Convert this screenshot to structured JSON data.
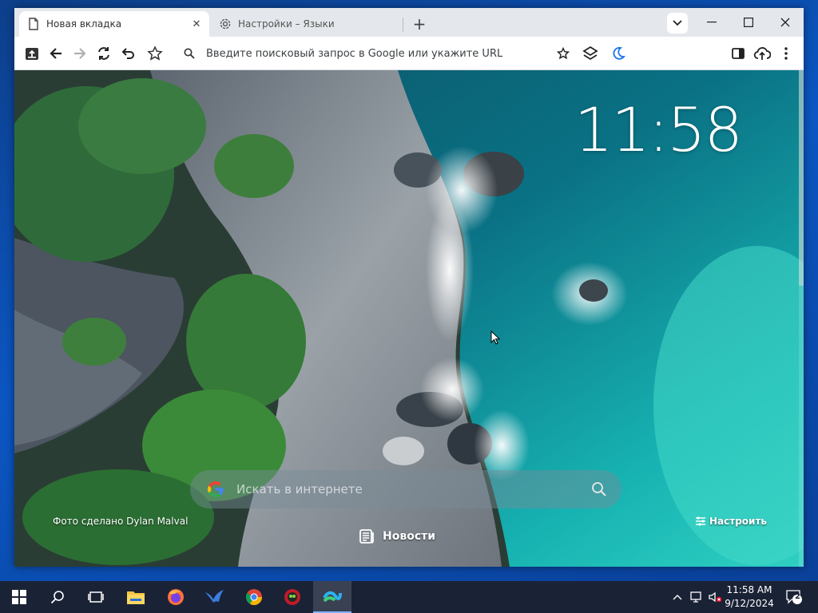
{
  "browser": {
    "tabs": [
      {
        "title": "Новая вкладка",
        "icon": "page-icon",
        "active": true
      },
      {
        "title": "Настройки – Языки",
        "icon": "gear-icon",
        "active": false
      }
    ],
    "new_tab_glyph": "+",
    "close_glyph": "✕"
  },
  "toolbar": {
    "omnibox_placeholder": "Введите поисковый запрос в Google или укажите URL"
  },
  "newtab": {
    "clock": "11:58",
    "search_placeholder": "Искать в интернете",
    "google_g": "G",
    "photo_credit": "Фото сделано Dylan Malval",
    "news_label": "Новости",
    "customize_label": "Настроить"
  },
  "taskbar": {
    "time": "11:58 AM",
    "date": "9/12/2024",
    "notification_count": "2",
    "apps": [
      "start",
      "search",
      "task-view",
      "file-explorer",
      "firefox",
      "falkon",
      "chrome",
      "opera-gx",
      "active-browser"
    ]
  },
  "colors": {
    "ocean": "#0e6f7a",
    "taskbar": "#1a2236",
    "desktop": "#0b56c2"
  }
}
